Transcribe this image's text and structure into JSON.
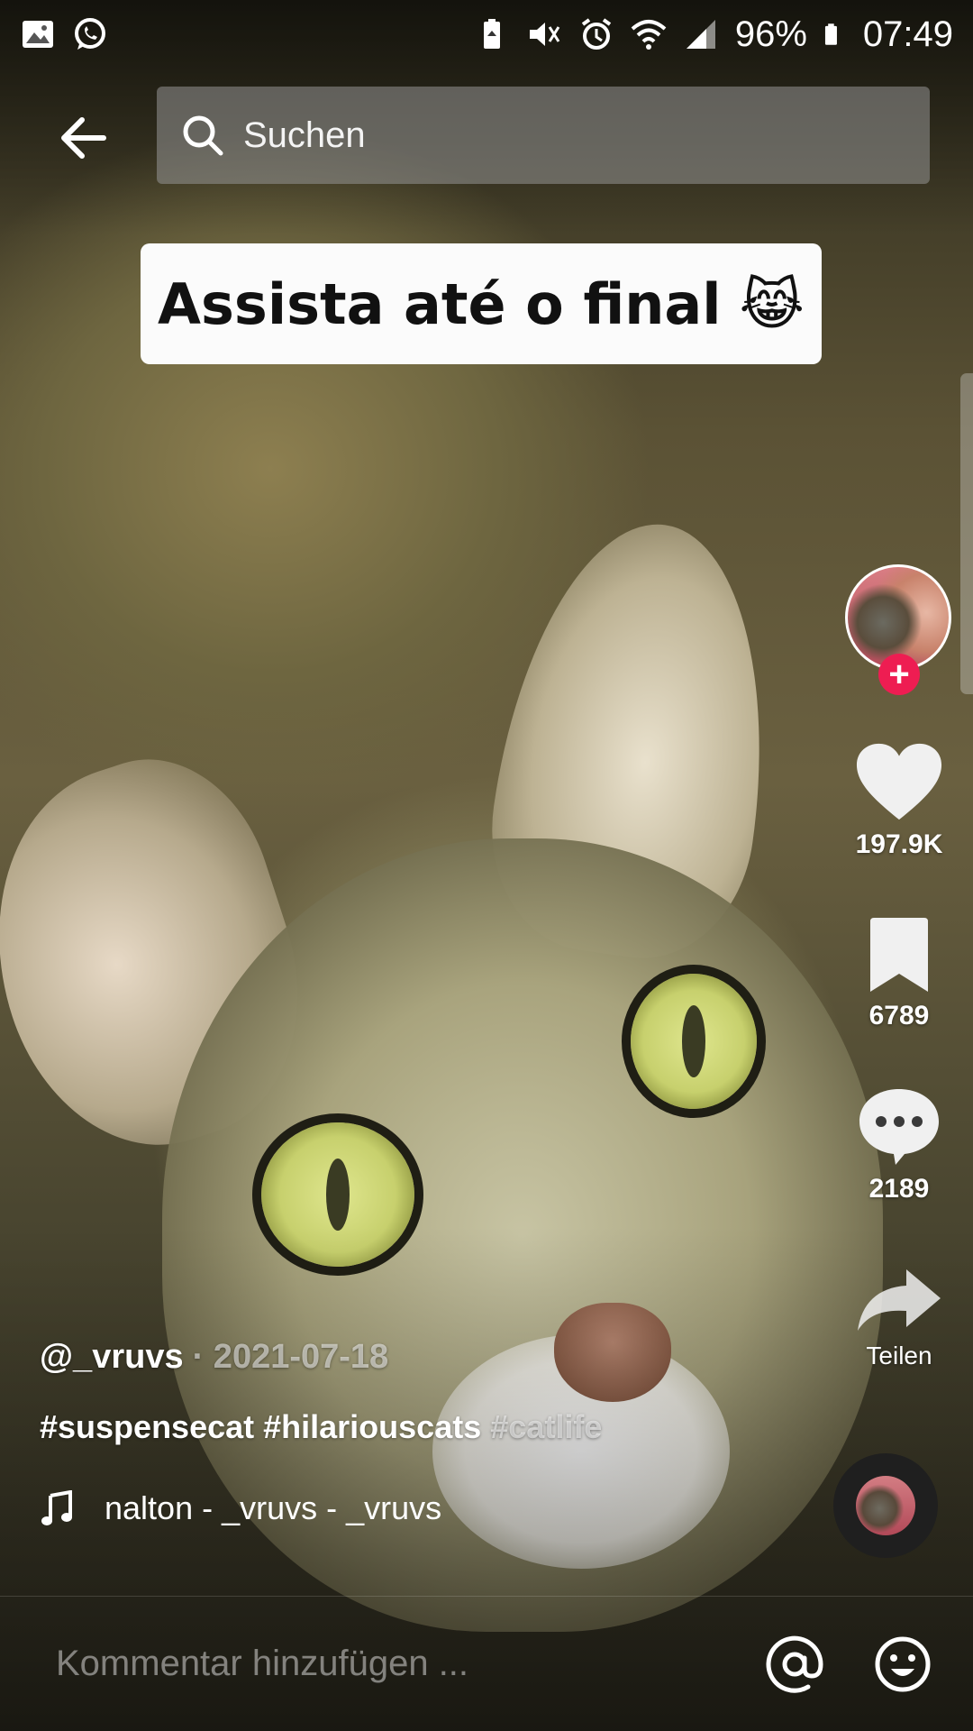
{
  "status_bar": {
    "battery": "96%",
    "time": "07:49",
    "icons": [
      "gallery-icon",
      "whatsapp-icon",
      "battery-saver-icon",
      "mute-icon",
      "alarm-icon",
      "wifi-icon",
      "signal-icon",
      "battery-icon"
    ]
  },
  "header": {
    "search_placeholder": "Suchen"
  },
  "video": {
    "caption": "Assista até o final",
    "caption_emoji": "😹"
  },
  "actions": {
    "likes": "197.9K",
    "saves": "6789",
    "comments": "2189",
    "share_label": "Teilen"
  },
  "post": {
    "username": "@_vruvs",
    "date": "· 2021-07-18",
    "hashtags_visible": "#suspensecat #hilariouscats",
    "hashtags_faded": "#catlife",
    "music": "nalton - _vruvs - _vruvs"
  },
  "comment_bar": {
    "placeholder": "Kommentar hinzufügen ..."
  },
  "colors": {
    "follow_badge": "#ee1d52",
    "search_bg": "#969696"
  }
}
